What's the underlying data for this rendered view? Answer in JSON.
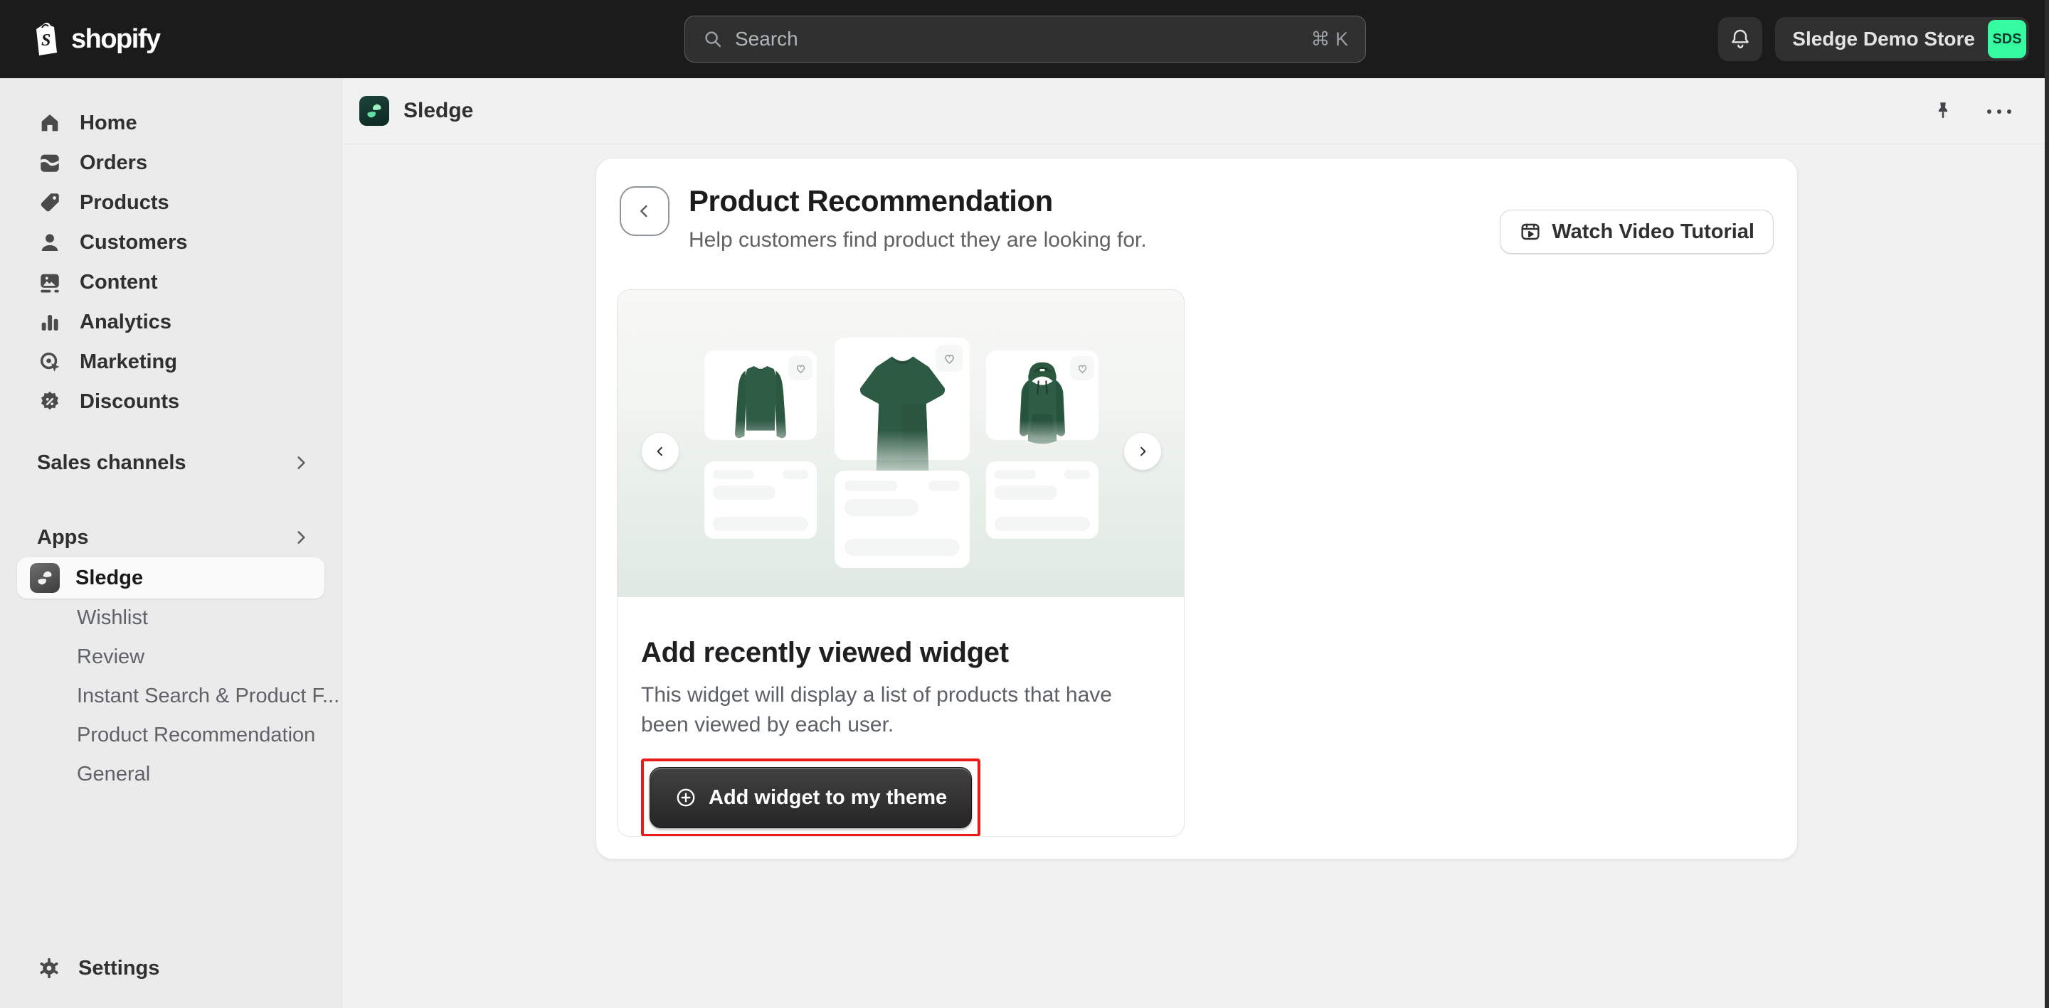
{
  "topbar": {
    "logo": "shopify",
    "search": {
      "placeholder": "Search",
      "shortcut": "⌘ K"
    },
    "store": {
      "name": "Sledge Demo Store",
      "badge": "SDS"
    }
  },
  "sidebar": {
    "items": [
      {
        "label": "Home",
        "icon": "home-icon"
      },
      {
        "label": "Orders",
        "icon": "orders-icon"
      },
      {
        "label": "Products",
        "icon": "tag-icon"
      },
      {
        "label": "Customers",
        "icon": "customers-icon"
      },
      {
        "label": "Content",
        "icon": "content-icon"
      },
      {
        "label": "Analytics",
        "icon": "analytics-icon"
      },
      {
        "label": "Marketing",
        "icon": "marketing-icon"
      },
      {
        "label": "Discounts",
        "icon": "discounts-icon"
      }
    ],
    "sales_channels_label": "Sales channels",
    "apps_label": "Apps",
    "app_selected": "Sledge",
    "app_subitems": [
      "Wishlist",
      "Review",
      "Instant Search & Product F...",
      "Product Recommendation",
      "General"
    ],
    "settings_label": "Settings"
  },
  "content_header": {
    "app_name": "Sledge"
  },
  "page": {
    "title": "Product Recommendation",
    "subtitle": "Help customers find product they are looking for.",
    "watch_video_label": "Watch Video Tutorial"
  },
  "preview": {
    "products": [
      "sweatshirt",
      "t-shirt",
      "hoodie"
    ]
  },
  "widget_section": {
    "heading": "Add recently viewed widget",
    "description": "This widget will display a list of products that have been viewed by each user.",
    "add_button_label": "Add widget to my theme"
  },
  "colors": {
    "topbar_bg": "#1b1b1b",
    "badge_green": "#36fba1",
    "product_green": "#2e5c44",
    "annotation_red": "#ec1a1a",
    "primary_button_bg": "#2b2b2b"
  }
}
